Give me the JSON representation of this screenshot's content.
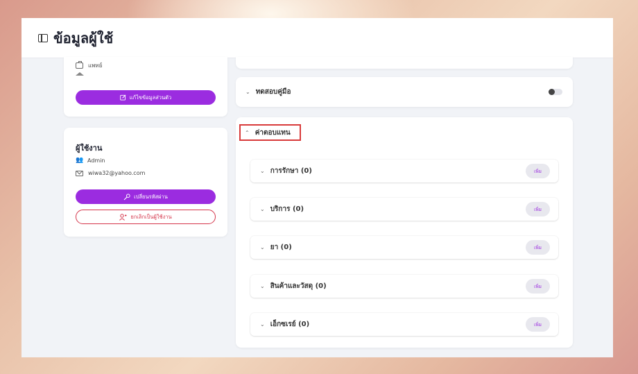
{
  "header": {
    "title": "ข้อมูลผู้ใช้",
    "icon": "sidebar-panel-icon"
  },
  "profile_card": {
    "position_text": "แพทย์",
    "education_text": "",
    "edit_button_label": "แก้ไขข้อมูลส่วนตัว"
  },
  "user_card": {
    "heading": "ผู้ใช้งาน",
    "username": "Admin",
    "email": "wiwa32@yahoo.com",
    "change_password_label": "เปลี่ยนรหัสผ่าน",
    "revoke_user_label": "ยกเลิกเป็นผู้ใช้งาน"
  },
  "manual_section": {
    "label": "ทดสอบคู่มือ",
    "toggle_on": false
  },
  "response_section": {
    "label": "ค่าตอบแทน",
    "add_label": "เพิ่ม",
    "items": [
      {
        "label": "การรักษา (0)"
      },
      {
        "label": "บริการ (0)"
      },
      {
        "label": "ยา (0)"
      },
      {
        "label": "สินค้าและวัสดุ (0)"
      },
      {
        "label": "เอ็กซเรย์ (0)"
      }
    ]
  },
  "colors": {
    "accent": "#9b2ce0",
    "danger": "#d4344a",
    "highlight_box": "#d83a3a"
  }
}
